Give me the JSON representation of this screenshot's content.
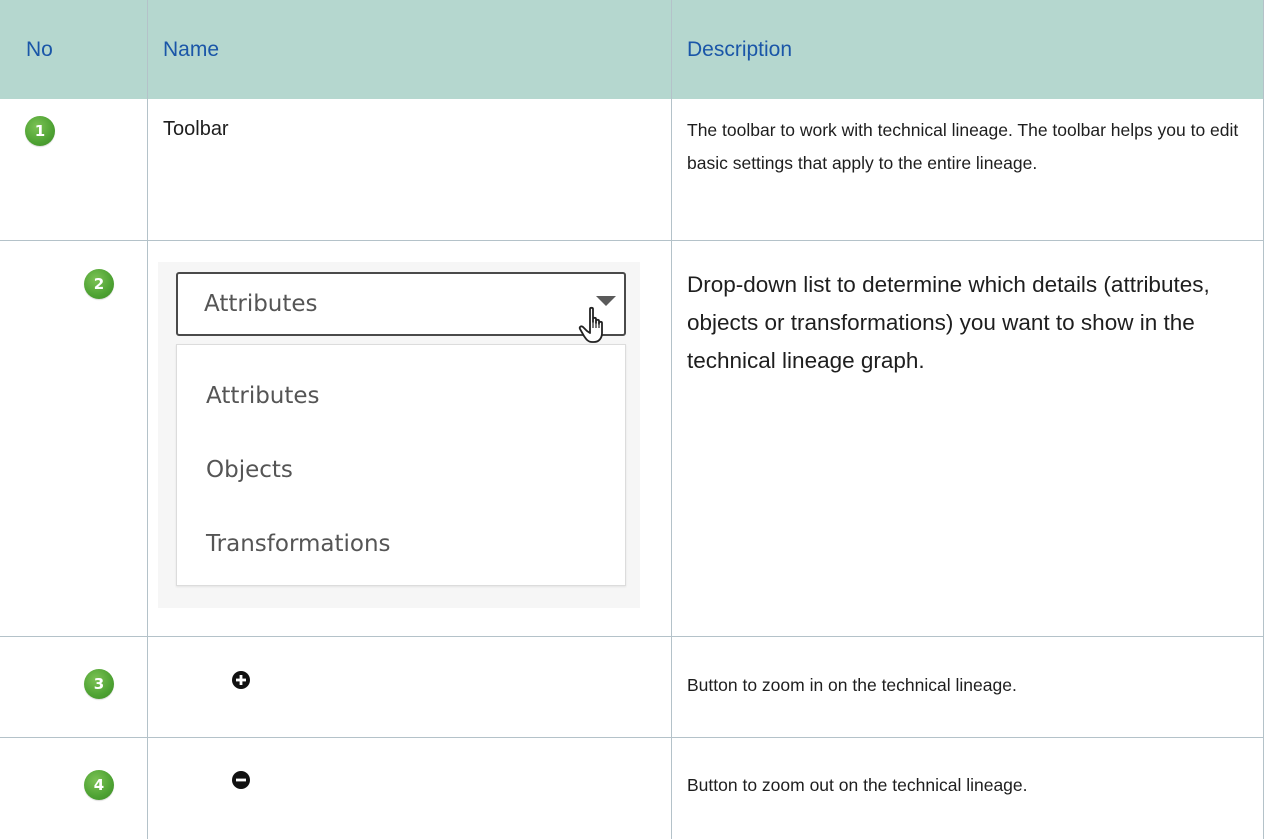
{
  "table": {
    "headers": {
      "no": "No",
      "name": "Name",
      "description": "Description"
    },
    "rows": [
      {
        "no": "1",
        "name": "Toolbar",
        "description": "The toolbar to work with technical lineage. The toolbar helps you to edit basic settings that apply to the entire lineage."
      },
      {
        "no": "2",
        "name_image": {
          "select_value": "Attributes",
          "options": [
            "Attributes",
            "Objects",
            "Transformations"
          ],
          "pointer_icon": "hand-pointer-icon",
          "caret_icon": "caret-down-icon"
        },
        "description": "Drop-down list to determine which details (attributes, objects or transformations) you want to show in the technical lineage graph."
      },
      {
        "no": "3",
        "name_icon": "plus-circle-icon",
        "description": "Button to zoom in on the technical lineage."
      },
      {
        "no": "4",
        "name_icon": "minus-circle-icon",
        "description": "Button to zoom out on the technical lineage."
      }
    ]
  },
  "colors": {
    "header_bg": "#b5d7cf",
    "header_text": "#1a56a8",
    "badge": "#4ea233",
    "grid": "#b4c2c9"
  }
}
